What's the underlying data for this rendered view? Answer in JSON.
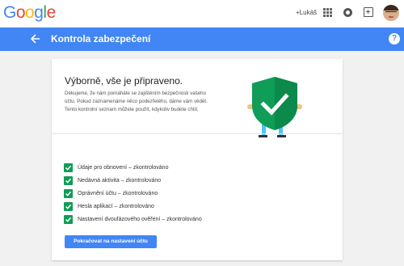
{
  "header": {
    "logo_letters": [
      {
        "char": "G",
        "color": "#4285f4"
      },
      {
        "char": "o",
        "color": "#ea4335"
      },
      {
        "char": "o",
        "color": "#fbbc05"
      },
      {
        "char": "g",
        "color": "#4285f4"
      },
      {
        "char": "l",
        "color": "#34a853"
      },
      {
        "char": "e",
        "color": "#ea4335"
      }
    ],
    "user_link": "+Lukáš",
    "icons": [
      "apps-icon",
      "notifications-icon",
      "share-icon",
      "avatar"
    ]
  },
  "bluebar": {
    "title": "Kontrola zabezpečení",
    "help": "?",
    "accent": "#4285f4"
  },
  "card": {
    "headline": "Výborně, vše je připraveno.",
    "description": "Děkujeme, že nám pomáháte se zajištěním bezpečnosti vašeho účtu. Pokud zaznamenáme něco podezřelého, dáme vám vědět. Tento kontrolní seznam můžete použít, kdykoliv budete chtít.",
    "checklist": [
      "Údaje pro obnovení – zkontrolováno",
      "Nedávná aktivita – zkontrolováno",
      "Oprávnění účtu – zkontrolováno",
      "Hesla aplikací – zkontrolováno",
      "Nastavení dvoufázového ověření – zkontrolováno"
    ],
    "continue_button": "Pokračovat na nastavení účtu",
    "check_color": "#0f9d58"
  }
}
